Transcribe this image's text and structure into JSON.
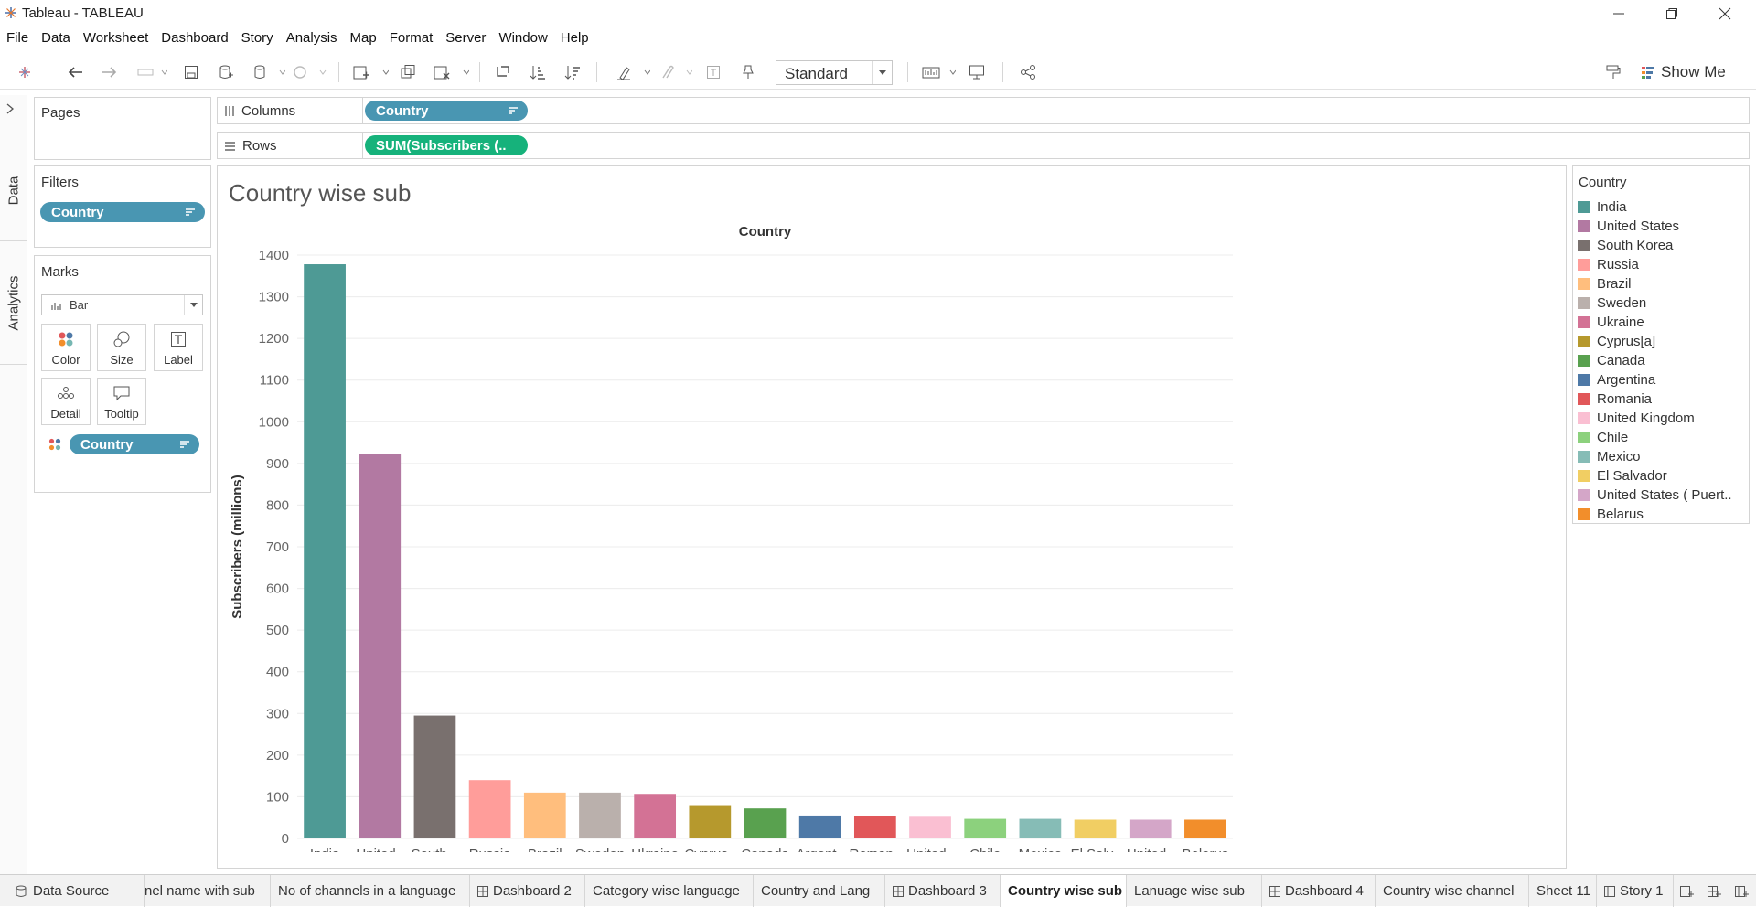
{
  "window": {
    "title": "Tableau - TABLEAU"
  },
  "menu": [
    "File",
    "Data",
    "Worksheet",
    "Dashboard",
    "Story",
    "Analysis",
    "Map",
    "Format",
    "Server",
    "Window",
    "Help"
  ],
  "toolbar": {
    "fit_select": "Standard",
    "show_me": "Show Me"
  },
  "side_tabs": {
    "data": "Data",
    "analytics": "Analytics"
  },
  "pages": {
    "title": "Pages"
  },
  "filters": {
    "title": "Filters",
    "pill": "Country"
  },
  "marks": {
    "title": "Marks",
    "type": "Bar",
    "cards": {
      "color": "Color",
      "size": "Size",
      "label": "Label",
      "detail": "Detail",
      "tooltip": "Tooltip"
    },
    "pill": "Country"
  },
  "shelves": {
    "columns": {
      "label": "Columns",
      "pill": "Country"
    },
    "rows": {
      "label": "Rows",
      "pill": "SUM(Subscribers (.."
    }
  },
  "sheet": {
    "title": "Country wise sub"
  },
  "legend": {
    "title": "Country",
    "items": [
      {
        "name": "India",
        "color": "#4e9a95"
      },
      {
        "name": "United States",
        "color": "#b279a2"
      },
      {
        "name": "South Korea",
        "color": "#79706e"
      },
      {
        "name": "Russia",
        "color": "#ff9d9a"
      },
      {
        "name": "Brazil",
        "color": "#ffbe7d"
      },
      {
        "name": "Sweden",
        "color": "#bab0ac"
      },
      {
        "name": "Ukraine",
        "color": "#d37295"
      },
      {
        "name": "Cyprus[a]",
        "color": "#b6992d"
      },
      {
        "name": "Canada",
        "color": "#59a14f"
      },
      {
        "name": "Argentina",
        "color": "#4e79a7"
      },
      {
        "name": "Romania",
        "color": "#e15759"
      },
      {
        "name": "United Kingdom",
        "color": "#fabfd2"
      },
      {
        "name": "Chile",
        "color": "#8cd17d"
      },
      {
        "name": "Mexico",
        "color": "#86bcb6"
      },
      {
        "name": "El Salvador",
        "color": "#f1ce63"
      },
      {
        "name": "United States ( Puert..",
        "color": "#d4a6c8"
      },
      {
        "name": "Belarus",
        "color": "#f28e2b"
      }
    ]
  },
  "chart_data": {
    "type": "bar",
    "title": "Country",
    "xlabel": "",
    "ylabel": "Subscribers (millions)",
    "ylim": [
      0,
      1400
    ],
    "yticks": [
      0,
      100,
      200,
      300,
      400,
      500,
      600,
      700,
      800,
      900,
      1000,
      1100,
      1200,
      1300,
      1400
    ],
    "grid": true,
    "categories": [
      "India",
      "United..",
      "South ..",
      "Russia",
      "Brazil",
      "Sweden",
      "Ukraine",
      "Cyprus..",
      "Canada",
      "Argent..",
      "Roman..",
      "United..",
      "Chile",
      "Mexico",
      "El Salv..",
      "United..",
      "Belarus"
    ],
    "values": [
      1378,
      922,
      295,
      140,
      110,
      110,
      107,
      80,
      72,
      55,
      53,
      52,
      47,
      47,
      45,
      45,
      45
    ],
    "colors": [
      "#4e9a95",
      "#b279a2",
      "#79706e",
      "#ff9d9a",
      "#ffbe7d",
      "#bab0ac",
      "#d37295",
      "#b6992d",
      "#59a14f",
      "#4e79a7",
      "#e15759",
      "#fabfd2",
      "#8cd17d",
      "#86bcb6",
      "#f1ce63",
      "#d4a6c8",
      "#f28e2b"
    ]
  },
  "tabs": [
    {
      "label": "Data Source",
      "icon": "database-icon"
    },
    {
      "label": "nel name with sub"
    },
    {
      "label": "No of channels in a language"
    },
    {
      "label": "Dashboard 2",
      "icon": "dashboard-icon"
    },
    {
      "label": "Category wise language"
    },
    {
      "label": "Country and Lang"
    },
    {
      "label": "Dashboard 3",
      "icon": "dashboard-icon"
    },
    {
      "label": "Country wise sub",
      "active": true
    },
    {
      "label": "Lanuage wise sub"
    },
    {
      "label": "Dashboard 4",
      "icon": "dashboard-icon"
    },
    {
      "label": "Country wise channel"
    },
    {
      "label": "Sheet 11"
    },
    {
      "label": "Story 1",
      "icon": "story-icon"
    }
  ]
}
